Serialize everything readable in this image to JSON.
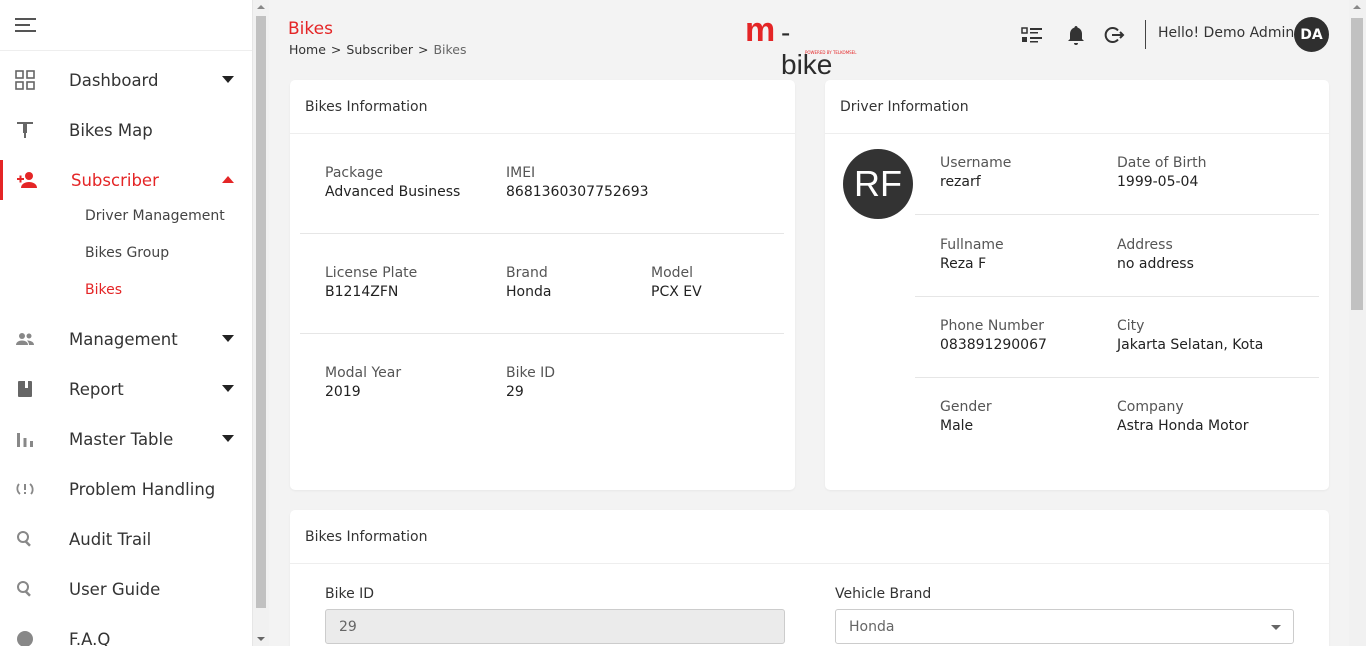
{
  "sidebar": {
    "items": [
      {
        "label": "Dashboard",
        "icon": "dashboard-icon"
      },
      {
        "label": "Bikes Map",
        "icon": "bike-icon"
      },
      {
        "label": "Subscriber",
        "icon": "add-user-icon"
      },
      {
        "label": "Management",
        "icon": "people-icon"
      },
      {
        "label": "Report",
        "icon": "book-icon"
      },
      {
        "label": "Master Table",
        "icon": "bar-chart-icon"
      },
      {
        "label": "Problem Handling",
        "icon": "sync-problem-icon"
      },
      {
        "label": "Audit Trail",
        "icon": "search-icon"
      },
      {
        "label": "User Guide",
        "icon": "search-icon"
      },
      {
        "label": "F.A.Q",
        "icon": "help-icon"
      }
    ],
    "sub_items": [
      "Driver Management",
      "Bikes Group",
      "Bikes"
    ]
  },
  "header": {
    "title": "Bikes",
    "breadcrumb": [
      "Home",
      "Subscriber",
      "Bikes"
    ],
    "breadcrumb_sep": ">",
    "logo_m": "m",
    "logo_text": "-bike",
    "logo_sub": "POWERED BY TELKOMSEL",
    "greeting": "Hello! Demo Admin",
    "avatar_initials": "DA"
  },
  "bike_info": {
    "title": "Bikes Information",
    "package_label": "Package",
    "package": "Advanced Business",
    "imei_label": "IMEI",
    "imei": "8681360307752693",
    "plate_label": "License Plate",
    "plate": "B1214ZFN",
    "brand_label": "Brand",
    "brand": "Honda",
    "model_label": "Model",
    "model": "PCX EV",
    "year_label": "Modal Year",
    "year": "2019",
    "bike_id_label": "Bike ID",
    "bike_id": "29"
  },
  "driver_info": {
    "title": "Driver Information",
    "avatar_initials": "RF",
    "username_label": "Username",
    "username": "rezarf",
    "dob_label": "Date of Birth",
    "dob": "1999-05-04",
    "fullname_label": "Fullname",
    "fullname": "Reza F",
    "address_label": "Address",
    "address": "no address",
    "phone_label": "Phone Number",
    "phone": "083891290067",
    "city_label": "City",
    "city": "Jakarta Selatan, Kota",
    "gender_label": "Gender",
    "gender": "Male",
    "company_label": "Company",
    "company": "Astra Honda Motor"
  },
  "bike_form": {
    "title": "Bikes Information",
    "bike_id_label": "Bike ID",
    "bike_id_value": "29",
    "brand_label": "Vehicle Brand",
    "brand_value": "Honda"
  },
  "colors": {
    "accent": "#e42526",
    "dark": "#2f2f2f"
  }
}
